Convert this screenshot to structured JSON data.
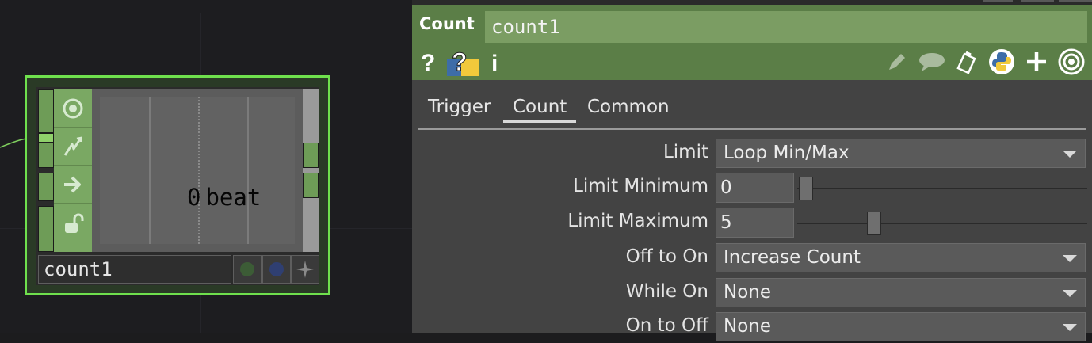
{
  "network": {
    "node": {
      "name": "count1",
      "value": "0",
      "unit": "beat",
      "flag_icons": [
        "target-icon",
        "lightning-icon",
        "arrow-right-icon",
        "unlock-icon"
      ],
      "button_colors": [
        "#3c5c36",
        "#2f3f72"
      ],
      "button_icons": [
        "viewer-toggle-icon",
        "display-toggle-icon",
        "star-icon"
      ]
    },
    "colors": {
      "selection": "#6fe04d",
      "chop_green": "#7aa863"
    }
  },
  "panel": {
    "op_type": "Count",
    "op_name": "count1",
    "header_icons_left": [
      "help-icon",
      "python-help-icon",
      "info-icon"
    ],
    "header_icons_right": [
      "edit-icon",
      "comment-icon",
      "clipboard-icon",
      "python-icon",
      "add-icon",
      "viewer-icon"
    ],
    "tabs": [
      {
        "label": "Trigger",
        "active": false
      },
      {
        "label": "Count",
        "active": true
      },
      {
        "label": "Common",
        "active": false
      }
    ],
    "params": {
      "limit": {
        "label": "Limit",
        "value": "Loop Min/Max"
      },
      "limit_min": {
        "label": "Limit Minimum",
        "value": "0",
        "fraction": 0.0
      },
      "limit_max": {
        "label": "Limit Maximum",
        "value": "5",
        "fraction": 0.25
      },
      "off_to_on": {
        "label": "Off to On",
        "value": "Increase Count"
      },
      "while_on": {
        "label": "While On",
        "value": "None"
      },
      "on_to_off": {
        "label": "On to Off",
        "value": "None"
      }
    },
    "colors": {
      "header": "#5b7e47",
      "name_field": "#7b9d63",
      "background": "#434343"
    }
  }
}
